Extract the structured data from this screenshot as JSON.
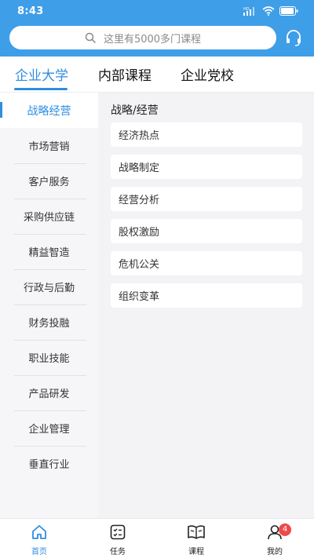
{
  "status_bar": {
    "time": "8:43"
  },
  "search": {
    "placeholder": "这里有5000多门课程"
  },
  "tabs": [
    {
      "label": "企业大学",
      "active": true
    },
    {
      "label": "内部课程",
      "active": false
    },
    {
      "label": "企业党校",
      "active": false
    }
  ],
  "sidebar": {
    "items": [
      {
        "label": "战略经营",
        "active": true
      },
      {
        "label": "市场营销"
      },
      {
        "label": "客户服务"
      },
      {
        "label": "采购供应链"
      },
      {
        "label": "精益智造"
      },
      {
        "label": "行政与后勤"
      },
      {
        "label": "财务投融"
      },
      {
        "label": "职业技能"
      },
      {
        "label": "产品研发"
      },
      {
        "label": "企业管理"
      },
      {
        "label": "垂直行业"
      }
    ]
  },
  "content": {
    "section_title": "战略/经营",
    "items": [
      "经济热点",
      "战略制定",
      "经营分析",
      "股权激励",
      "危机公关",
      "组织变革"
    ]
  },
  "bottom_nav": {
    "items": [
      {
        "label": "首页",
        "icon": "home-icon",
        "active": true
      },
      {
        "label": "任务",
        "icon": "task-list-icon"
      },
      {
        "label": "课程",
        "icon": "book-icon"
      },
      {
        "label": "我的",
        "icon": "user-icon",
        "badge": "4"
      }
    ]
  },
  "colors": {
    "header": "#3f9ee8",
    "accent": "#2f8ee0",
    "badge": "#f04848"
  }
}
